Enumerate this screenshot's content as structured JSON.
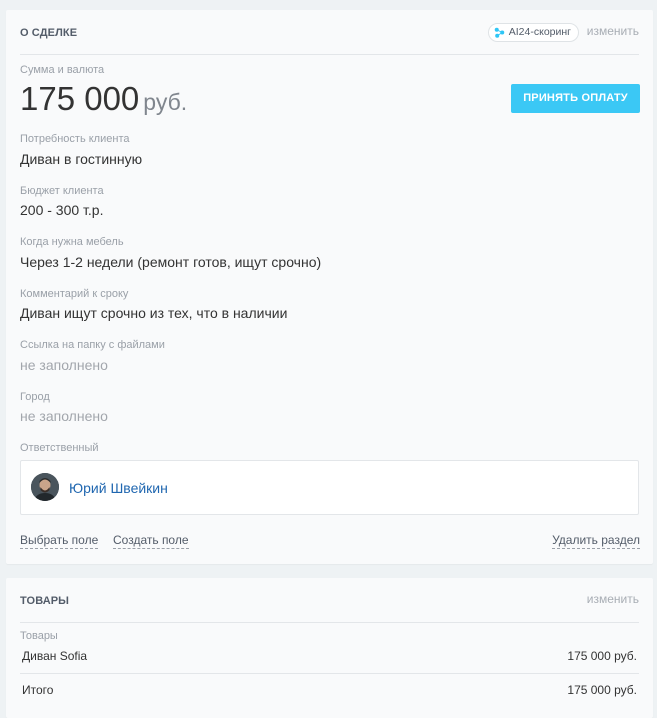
{
  "deal": {
    "section_title": "О СДЕЛКЕ",
    "scoring_badge": "AI24-скоринг",
    "edit_label": "изменить",
    "amount_label": "Сумма и валюта",
    "amount_value": "175 000",
    "currency": "руб.",
    "pay_button": "ПРИНЯТЬ ОПЛАТУ",
    "fields": [
      {
        "label": "Потребность клиента",
        "value": "Диван в гостинную"
      },
      {
        "label": "Бюджет клиента",
        "value": "200 - 300 т.р."
      },
      {
        "label": "Когда нужна мебель",
        "value": "Через 1-2 недели (ремонт готов, ищут срочно)"
      },
      {
        "label": "Комментарий к сроку",
        "value": "Диван ищут срочно из тех, что в наличии"
      },
      {
        "label": "Ссылка на папку с файлами",
        "value": "не заполнено"
      },
      {
        "label": "Город",
        "value": "не заполнено"
      }
    ],
    "responsible_label": "Ответственный",
    "responsible_name": "Юрий Швейкин",
    "select_field_link": "Выбрать поле",
    "create_field_link": "Создать поле",
    "delete_section_link": "Удалить раздел"
  },
  "goods": {
    "section_title": "ТОВАРЫ",
    "edit_label": "изменить",
    "list_label": "Товары",
    "items": [
      {
        "name": "Диван Sofia",
        "sum": "175 000 руб."
      }
    ],
    "total_label": "Итого",
    "total_sum": "175 000 руб."
  },
  "colors": {
    "accent": "#3bc8f5",
    "link": "#2067b0",
    "background": "#eef2f4"
  },
  "icons": {
    "scoring": "ai-scoring-icon",
    "avatar": "user-avatar"
  }
}
